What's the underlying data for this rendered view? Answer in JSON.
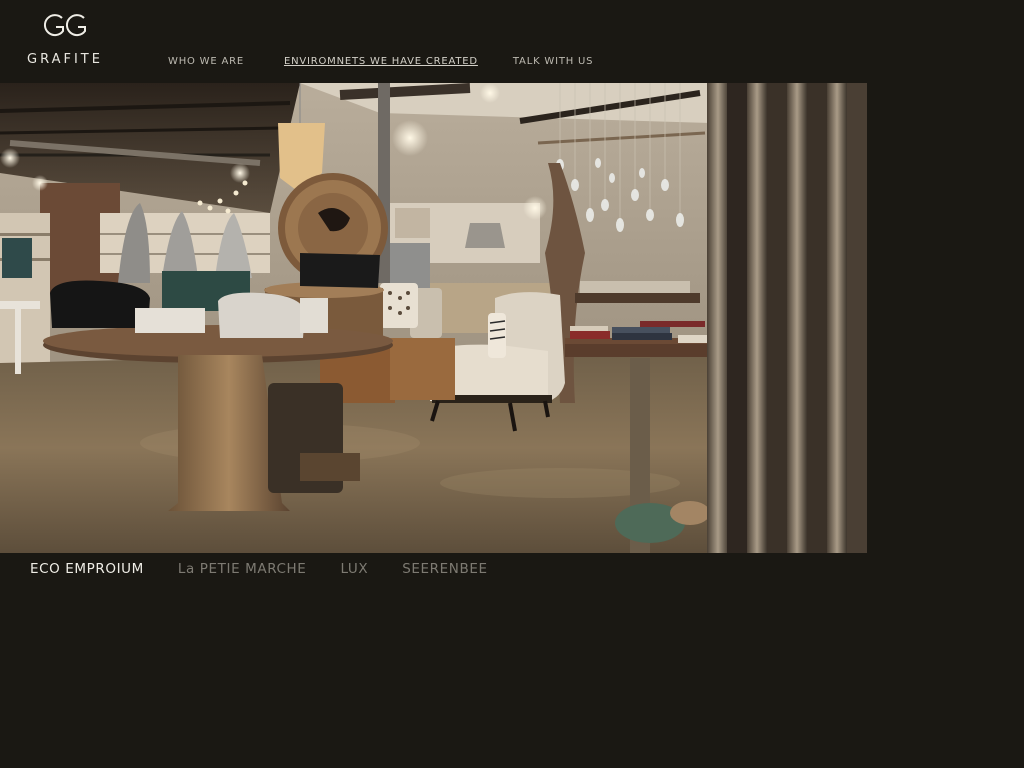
{
  "brand": {
    "logo_mark": "GG",
    "name": "GRAFITE"
  },
  "nav": {
    "items": [
      {
        "label": "WHO WE ARE"
      },
      {
        "label": "ENVIROMNETS WE HAVE CREATED",
        "active": true
      },
      {
        "label": "TALK WITH US"
      }
    ]
  },
  "hero": {
    "image_icon": "store-interior-photo"
  },
  "subnav": {
    "items": [
      {
        "label": "ECO EMPROIUM",
        "active": true
      },
      {
        "label": "La PETIE MARCHE"
      },
      {
        "label": "LUX"
      },
      {
        "label": "SEERENBEE"
      }
    ]
  },
  "colors": {
    "background": "#1a1813",
    "text_active": "#efede6",
    "text_inactive": "#7d7a72"
  }
}
